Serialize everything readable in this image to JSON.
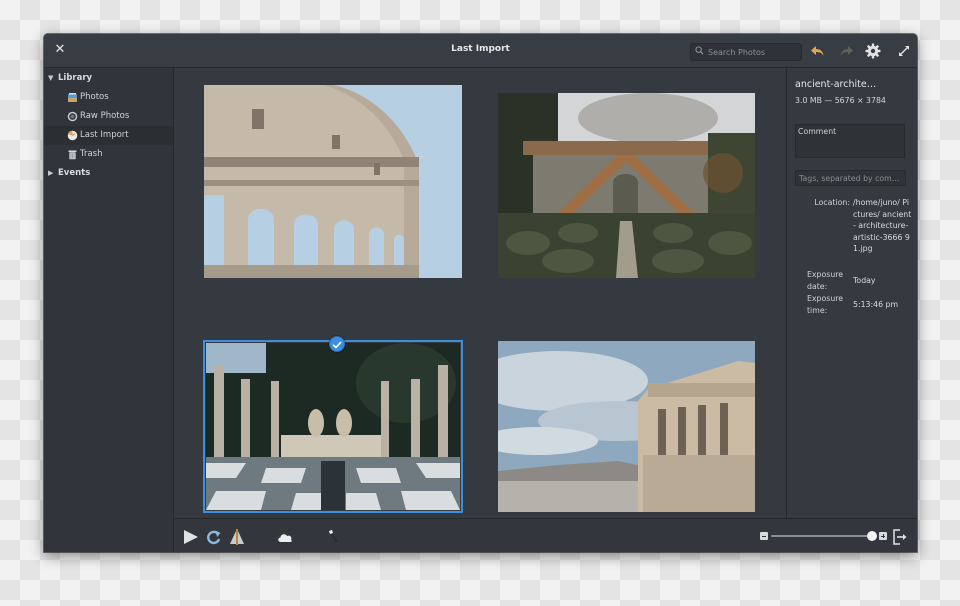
{
  "window": {
    "title": "Last Import",
    "search_placeholder": "Search Photos"
  },
  "sidebar": {
    "library_label": "Library",
    "items": [
      {
        "label": "Photos",
        "icon": "photos-icon"
      },
      {
        "label": "Raw Photos",
        "icon": "raw-photos-icon"
      },
      {
        "label": "Last Import",
        "icon": "last-import-icon",
        "selected": true
      },
      {
        "label": "Trash",
        "icon": "trash-icon"
      }
    ],
    "events_label": "Events"
  },
  "photos": [
    {
      "subject": "Colosseum facade",
      "selected": false
    },
    {
      "subject": "Garden staircase with hedges",
      "selected": false
    },
    {
      "subject": "Statues and columns with checkered floor",
      "selected": true
    },
    {
      "subject": "Acropolis Caryatids",
      "selected": false
    }
  ],
  "info": {
    "filename": "ancient-archite…",
    "size_dims": "3.0 MB — 5676 × 3784",
    "comment_placeholder": "Comment",
    "tags_placeholder": "Tags, separated by com…",
    "location_label": "Location:",
    "location_value": "/home/juno/ Pictures/ ancient- architecture- artistic-3666 91.jpg",
    "exposure_date_label": "Exposure date:",
    "exposure_date_value": "Today",
    "exposure_time_label": "Exposure time:",
    "exposure_time_value": "5:13:46 pm"
  },
  "zoom_slider": {
    "value": 0.95
  },
  "colors": {
    "accent": "#3d8fdc",
    "undo": "#e9a34a"
  }
}
